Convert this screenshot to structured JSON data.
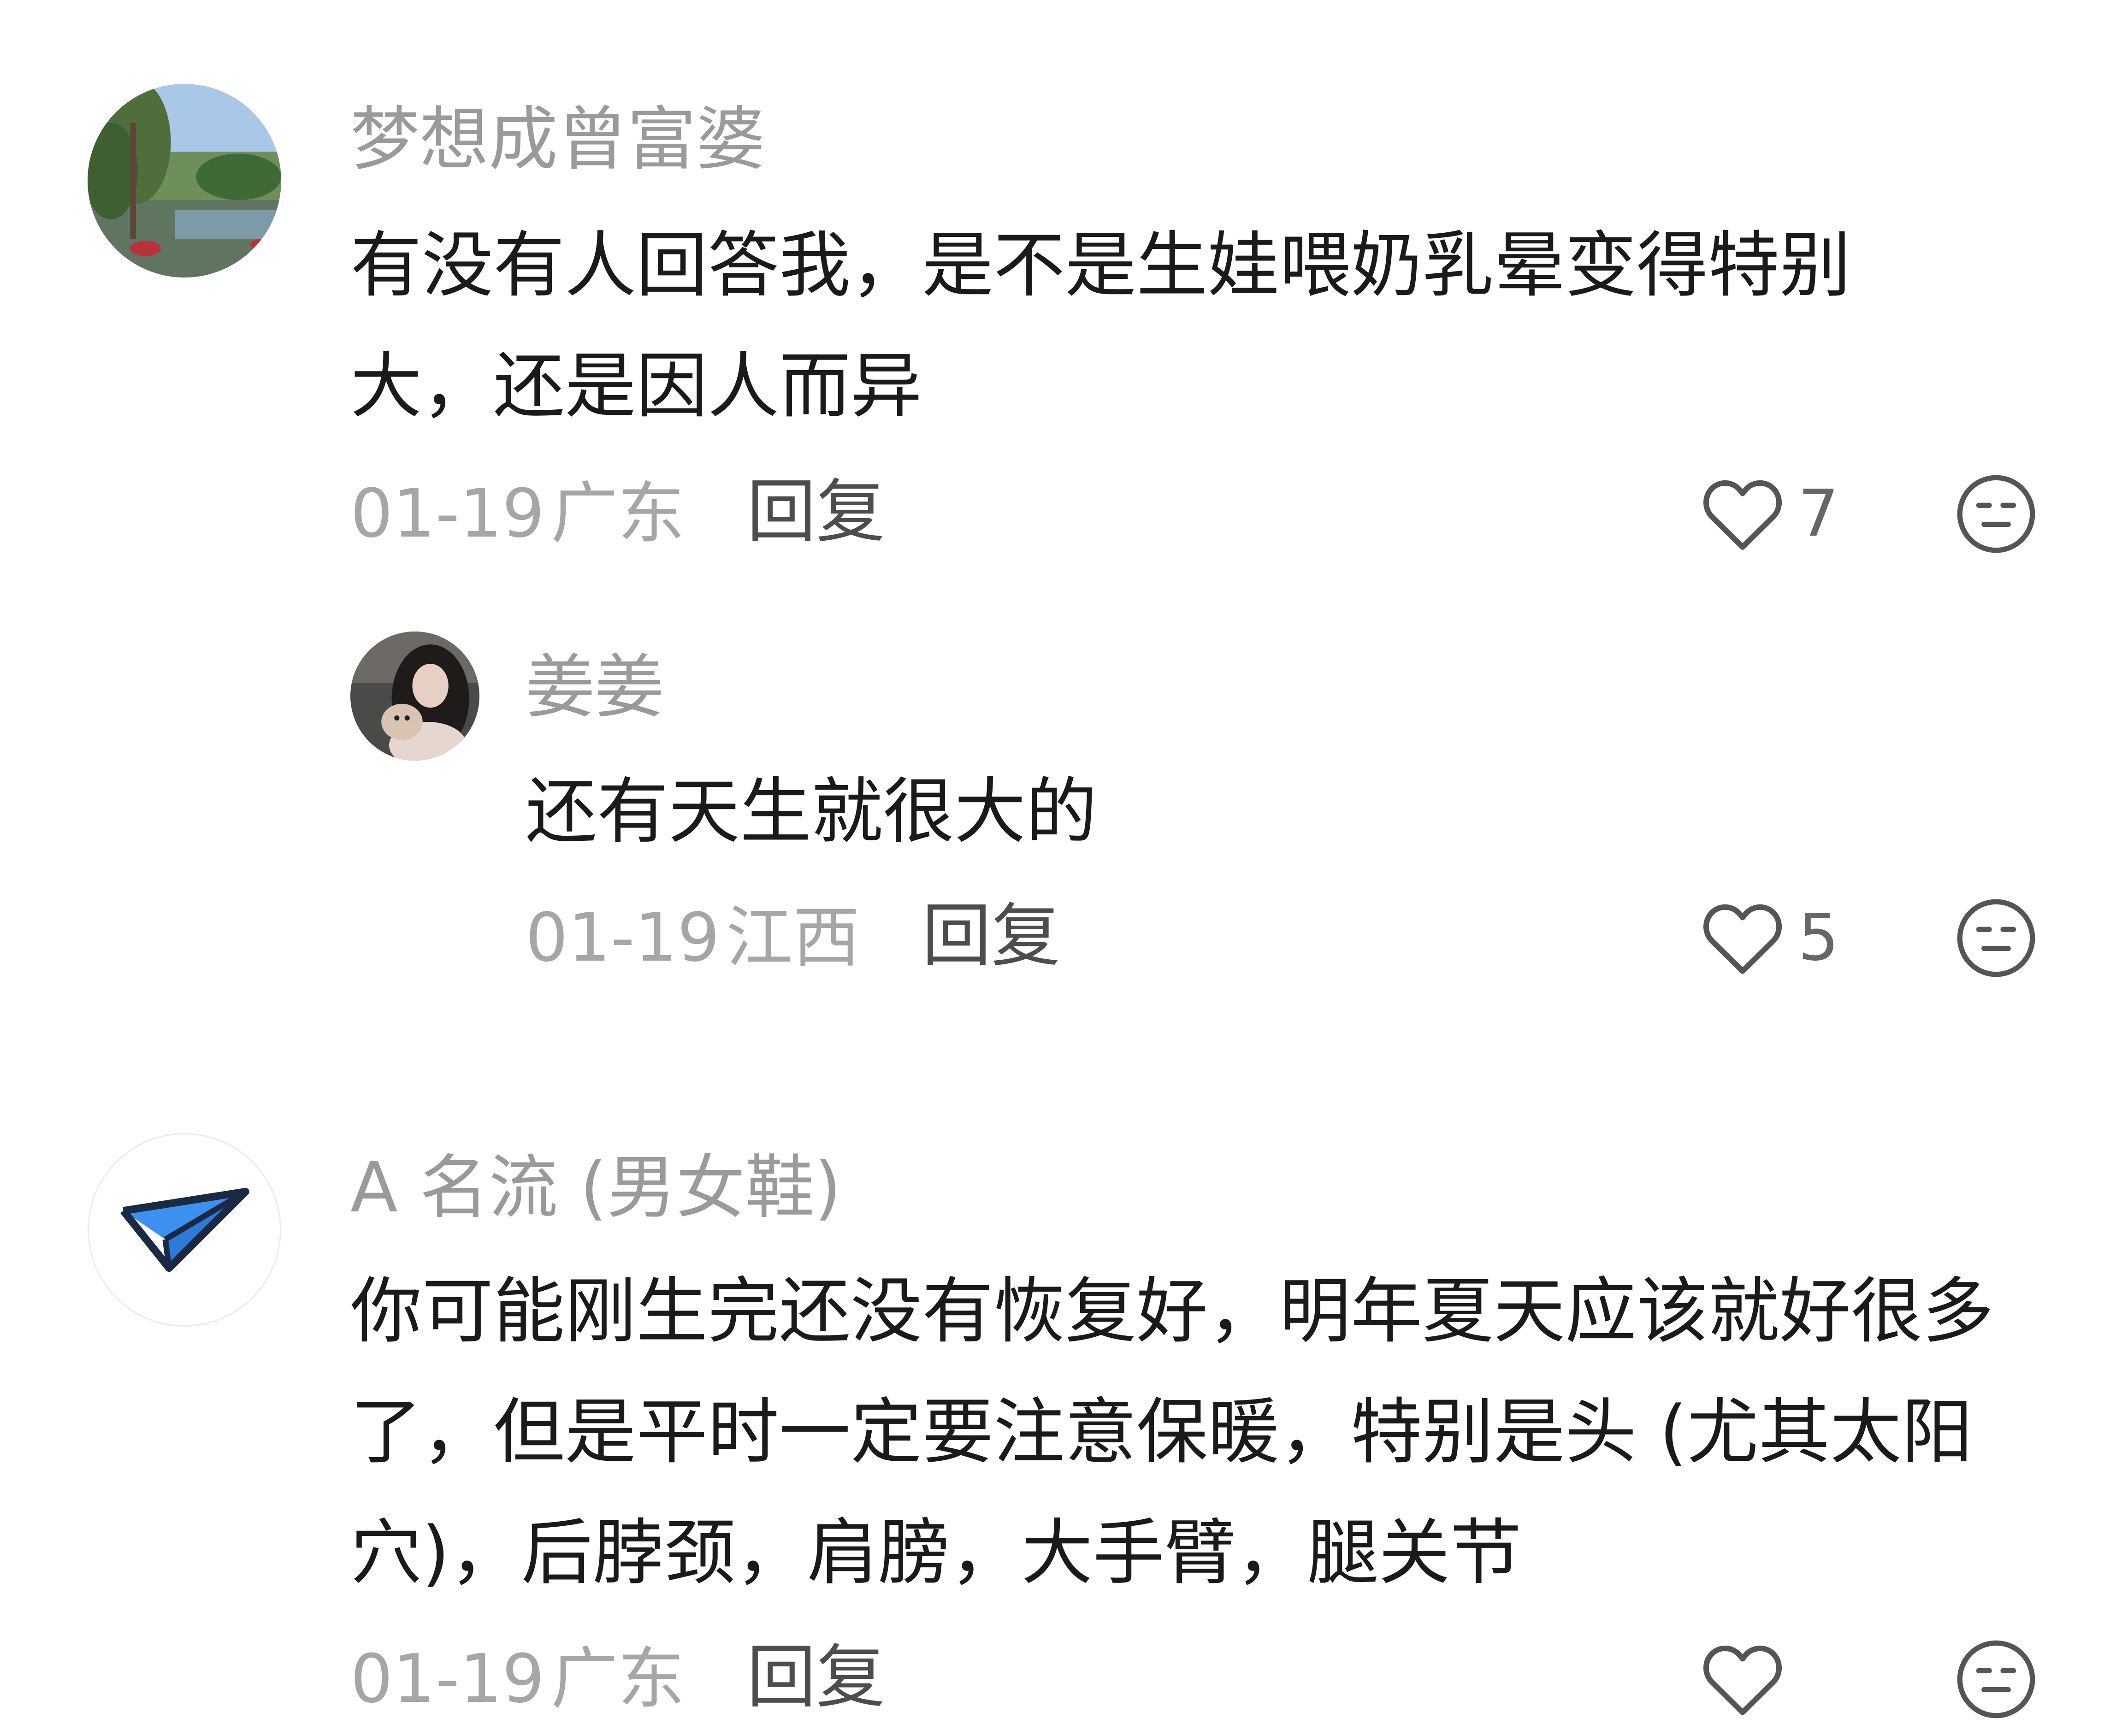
{
  "comments": [
    {
      "username": "梦想成曾富婆",
      "avatar_icon": "landscape-lake-avatar",
      "content": "有没有人回答我，是不是生娃喂奶乳晕变得特别大，还是因人而异",
      "date": "01-19",
      "location": "广东",
      "reply_label": "回复",
      "likes": "7",
      "reply": {
        "username": "姜姜",
        "avatar_icon": "woman-with-dog-avatar",
        "content": "还有天生就很大的",
        "date": "01-19",
        "location": "江西",
        "reply_label": "回复",
        "likes": "5"
      }
    },
    {
      "username": "A 名流 (男女鞋)",
      "avatar_icon": "paper-plane-avatar",
      "content": "你可能刚生完还没有恢复好，明年夏天应该就好很多了，但是平时一定要注意保暖，特别是头 (尤其太阳穴)，后脖颈，肩膀，大手臂，腿关节",
      "date": "01-19",
      "location": "广东",
      "reply_label": "回复",
      "likes": ""
    }
  ],
  "colors": {
    "username": "#9a9a9a",
    "content": "#1a1a1a",
    "meta": "#a6a6a6",
    "reply": "#4d4d4d",
    "icon": "#555555",
    "plane": "#3d8ff0"
  }
}
